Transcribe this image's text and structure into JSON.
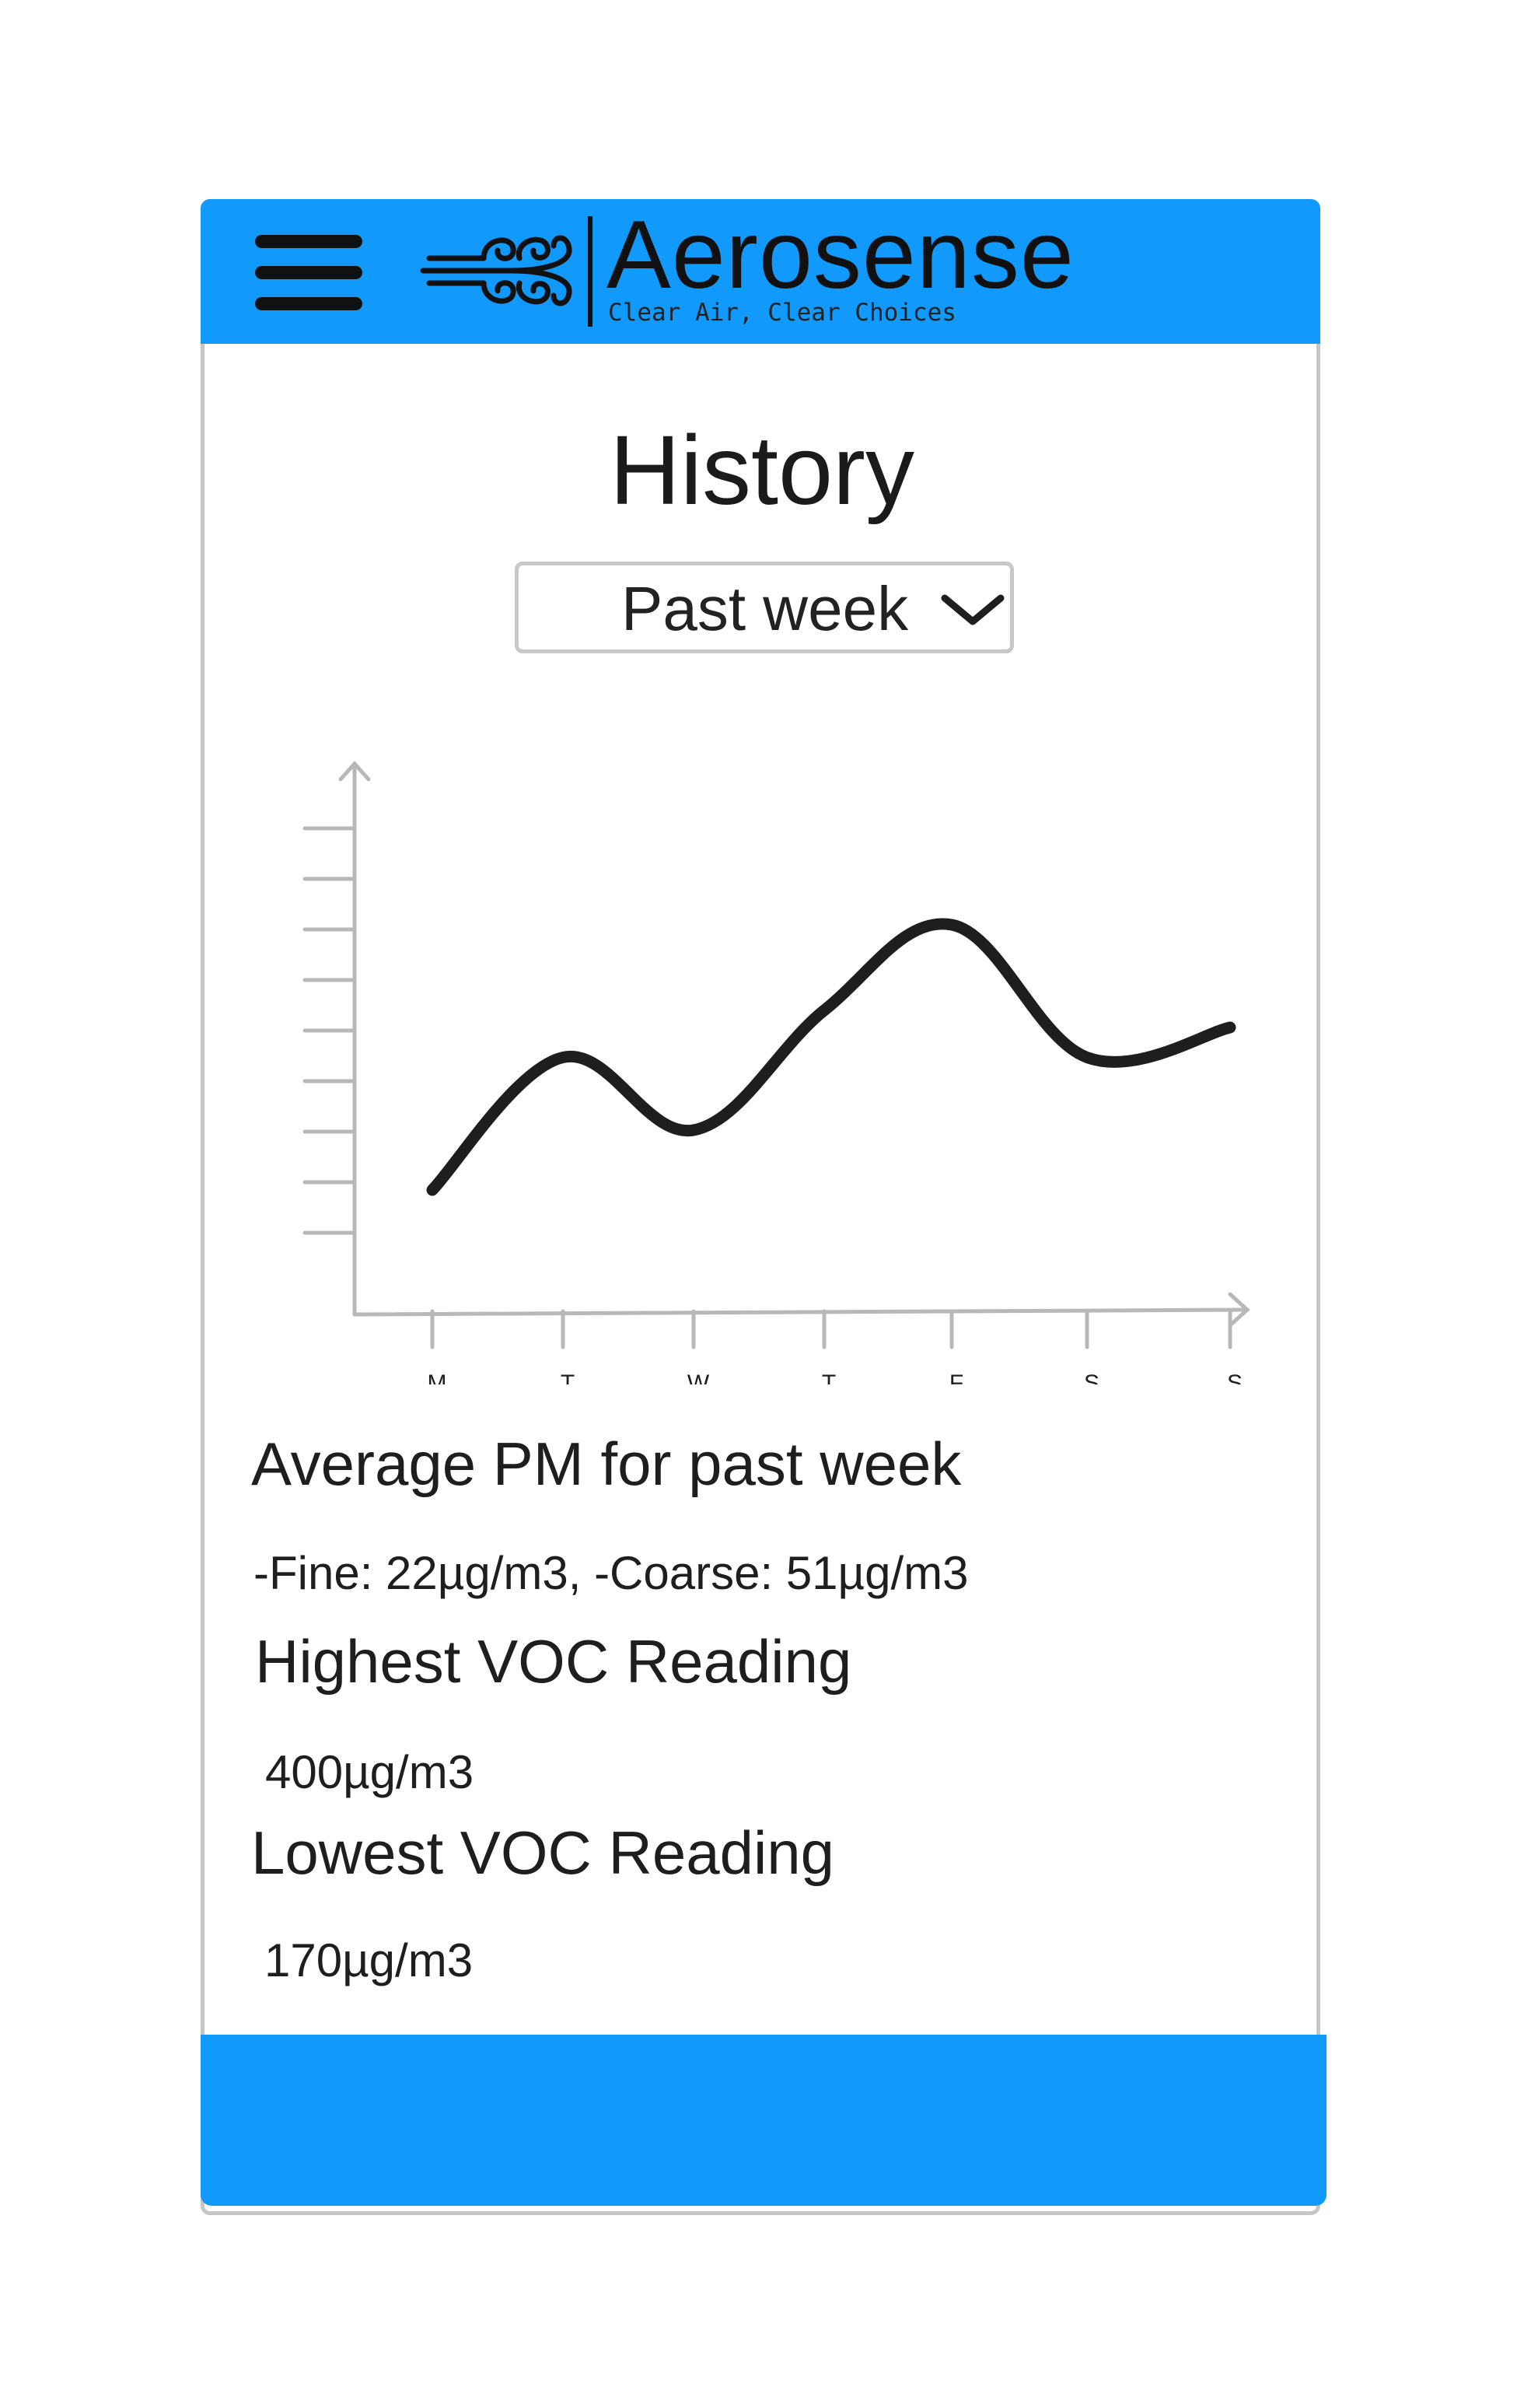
{
  "app": {
    "brand_name": "Aerosense",
    "tagline": "Clear Air, Clear Choices",
    "accent_color": "#1199fb"
  },
  "header": {
    "menu_icon": "hamburger-menu-icon",
    "logo_icon": "wind-swirl-icon"
  },
  "page": {
    "title": "History"
  },
  "range_select": {
    "value": "Past week",
    "icon": "chevron-down-icon"
  },
  "chart_data": {
    "type": "line",
    "categories": [
      "M",
      "T",
      "W",
      "T",
      "F",
      "S",
      "S"
    ],
    "values": [
      2.0,
      5.1,
      3.4,
      6.2,
      8.2,
      5.1,
      5.8
    ],
    "ylim": [
      0,
      10
    ],
    "title": "",
    "xlabel": "",
    "ylabel": "",
    "grid": false,
    "line_color": "#1e1e1e"
  },
  "stats": {
    "average_pm_heading": "Average PM for past week",
    "average_pm_value": "-Fine: 22µg/m3, -Coarse: 51µg/m3",
    "highest_voc_heading": "Highest VOC Reading",
    "highest_voc_value": "400µg/m3",
    "lowest_voc_heading": "Lowest VOC Reading",
    "lowest_voc_value": "170µg/m3"
  }
}
